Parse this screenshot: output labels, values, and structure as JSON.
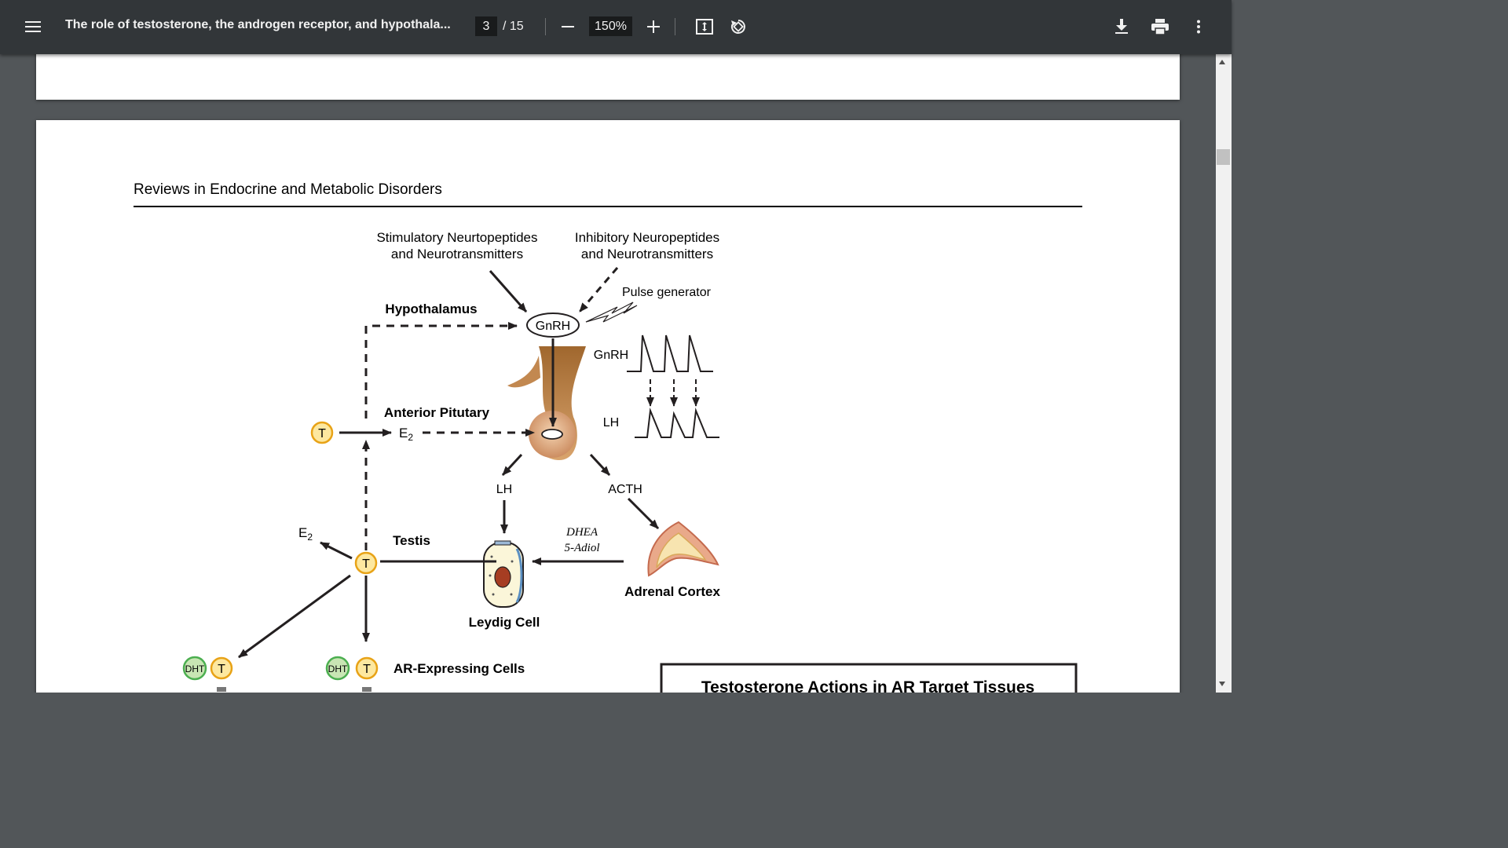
{
  "toolbar": {
    "title": "The role of testosterone, the androgen receptor, and hypothala...",
    "page_current": "3",
    "page_total": "/ 15",
    "zoom": "150%"
  },
  "icons": {
    "menu": "hamburger-menu-icon",
    "zoom_out": "minus-icon",
    "zoom_in": "plus-icon",
    "fit": "fit-to-page-icon",
    "rotate": "rotate-icon",
    "download": "download-icon",
    "print": "print-icon",
    "more": "more-vert-icon"
  },
  "page3": {
    "journal": "Reviews in Endocrine and Metabolic Disorders",
    "figure": {
      "stim_line1": "Stimulatory Neurtopeptides",
      "stim_line2": "and Neurotransmitters",
      "inhib_line1": "Inhibitory Neuropeptides",
      "inhib_line2": "and Neurotransmitters",
      "pulse_generator": "Pulse generator",
      "hypothalamus": "Hypothalamus",
      "gnrh_oval": "GnRH",
      "gnrh_trace": "GnRH",
      "lh_trace": "LH",
      "anterior_pituitary": "Anterior Pitutary",
      "t": "T",
      "e": "E",
      "sub2": "2",
      "lh": "LH",
      "acth": "ACTH",
      "dhea": "DHEA",
      "adiol": "5-Adiol",
      "testis": "Testis",
      "adrenal_cortex": "Adrenal Cortex",
      "leydig_cell": "Leydig Cell",
      "dht": "DHT",
      "ar_cells": "AR-Expressing Cells",
      "box_title": "Testosterone Actions in AR Target Tissues"
    }
  },
  "colors": {
    "toolbar_bg": "#323639",
    "viewer_bg": "#525659",
    "t_circle_fill": "#fde8a0",
    "t_circle_stroke": "#e8a317",
    "dht_fill": "#c9e6b4",
    "dht_stroke": "#4caf50"
  }
}
